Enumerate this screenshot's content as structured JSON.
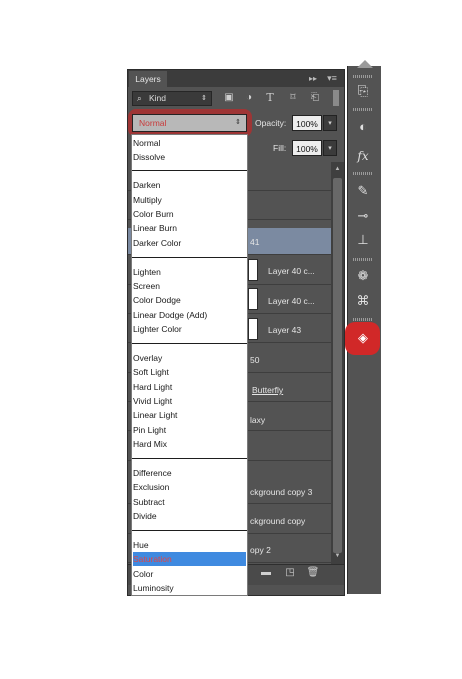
{
  "panel": {
    "tab_label": "Layers",
    "collapse_glyph": "▸▸",
    "menu_glyph": "▾≡"
  },
  "filter": {
    "kind_label": "Kind",
    "search_glyph": "⌕",
    "arrow_glyph": "⇕",
    "icons": [
      "image-filter-icon",
      "adjustment-filter-icon",
      "type-filter-icon",
      "shape-filter-icon",
      "smart-object-filter-icon"
    ]
  },
  "blend": {
    "value": "Normal",
    "arrow": "⇕"
  },
  "opacity": {
    "label": "Opacity:",
    "value": "100%",
    "arrow": "▾"
  },
  "fill": {
    "label": "Fill:",
    "value": "100%",
    "arrow": "▾"
  },
  "blend_modes": {
    "group1": [
      "Normal",
      "Dissolve"
    ],
    "group2": [
      "Darken",
      "Multiply",
      "Color Burn",
      "Linear Burn",
      "Darker Color"
    ],
    "group3": [
      "Lighten",
      "Screen",
      "Color Dodge",
      "Linear Dodge (Add)",
      "Lighter Color"
    ],
    "group4": [
      "Overlay",
      "Soft Light",
      "Hard Light",
      "Vivid Light",
      "Linear Light",
      "Pin Light",
      "Hard Mix"
    ],
    "group5": [
      "Difference",
      "Exclusion",
      "Subtract",
      "Divide"
    ],
    "group6": [
      "Hue",
      "Saturation",
      "Color",
      "Luminosity"
    ],
    "highlighted": "Saturation"
  },
  "layers": [
    {
      "name": "",
      "selected": false
    },
    {
      "name": "",
      "selected": false
    },
    {
      "name": "41",
      "selected": true
    },
    {
      "name": "Layer 40 c...",
      "selected": false
    },
    {
      "name": "Layer 40 c...",
      "selected": false
    },
    {
      "name": "Layer 43",
      "selected": false
    },
    {
      "name": "50",
      "selected": false
    },
    {
      "name": "Butterfly",
      "selected": false
    },
    {
      "name": "laxy",
      "selected": false
    },
    {
      "name": "",
      "selected": false
    },
    {
      "name": "ckground copy 3",
      "selected": false
    },
    {
      "name": "ckground copy",
      "selected": false
    },
    {
      "name": "opy 2",
      "selected": false
    }
  ],
  "scroll": {
    "up": "▲",
    "down": "▼"
  },
  "bottom_icons": {
    "group": "▬",
    "new_layer": "◳",
    "delete": "🗑"
  },
  "dock": {
    "history": "⎘",
    "adjust": "◐",
    "fx": "fx",
    "brush": "✎",
    "tool_presets": "⊸",
    "clone": "⊥",
    "channels": "❁",
    "paths": "⌘",
    "layers": "◈"
  },
  "colors": {
    "panel_bg": "#535353",
    "selected_layer": "#7b8aa1",
    "highlight_red": "#d12828",
    "dropdown_highlight": "#3f8ae0"
  }
}
